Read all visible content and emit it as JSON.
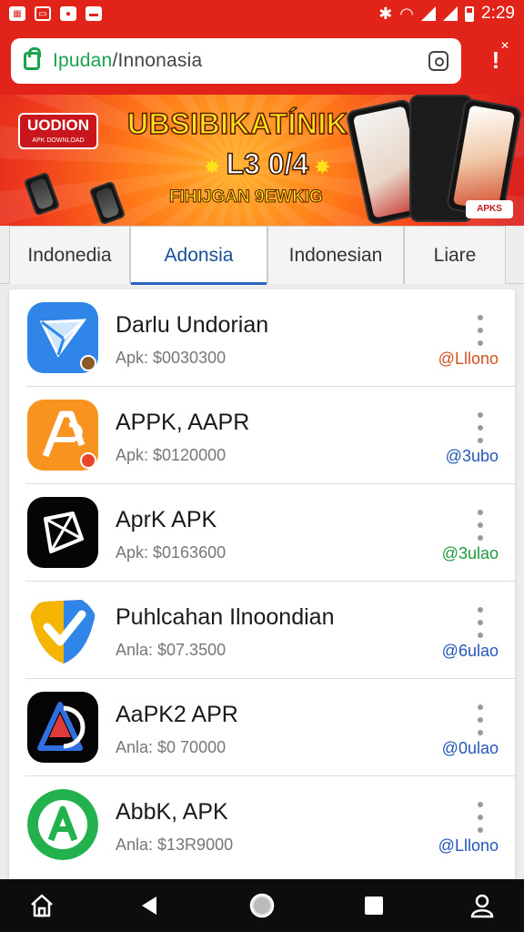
{
  "status_bar": {
    "left_icons": [
      "photo-notification-icon",
      "calendar-notification-icon",
      "chat-notification-icon",
      "video-notification-icon"
    ],
    "right_icons": [
      "bluetooth-icon",
      "wifi-icon",
      "signal-icon",
      "signal-icon",
      "battery-icon"
    ],
    "time": "2:29"
  },
  "browser": {
    "url_host": "Ipudan",
    "url_path": "/Innonasia"
  },
  "banner": {
    "logo_text": "UODION",
    "logo_subtext": "APK DOWNLOAD",
    "headline": "UBSIBIKATÍNIK!",
    "subheadline": "L3 0/4",
    "tagline": "FIHIJGAN 9EWKIG",
    "corner_badge": "APKS"
  },
  "tabs": [
    {
      "label": "Indonedia",
      "active": false
    },
    {
      "label": "Adonsia",
      "active": true
    },
    {
      "label": "Indonesian",
      "active": false
    },
    {
      "label": "Liare",
      "active": false
    }
  ],
  "apps": [
    {
      "name": "Darlu Undorian",
      "meta": "Apk: $0030300",
      "size": "@Lllono",
      "size_color": "#d1501e",
      "icon": "paper-plane-app-icon"
    },
    {
      "name": "APPK, AAPR",
      "meta": "Apk: $0120000",
      "size": "@3ubo",
      "size_color": "#2457b8",
      "icon": "letter-a-app-icon"
    },
    {
      "name": "AprK APK",
      "meta": "Apk: $0163600",
      "size": "@3ulao",
      "size_color": "#1f9a3c",
      "icon": "geometric-diamond-app-icon"
    },
    {
      "name": "Puhlcahan Ilnoondian",
      "meta": "Anla: $07.3500",
      "size": "@6ulao",
      "size_color": "#2457b8",
      "icon": "colorful-checkmark-app-icon"
    },
    {
      "name": "AaPK2 APR",
      "meta": "Anla: $0 70000",
      "size": "@0ulao",
      "size_color": "#2457b8",
      "icon": "triangle-a-app-icon"
    },
    {
      "name": "AbbK, APK",
      "meta": "Anla: $13R9000",
      "size": "@Lllono",
      "size_color": "#2457b8",
      "icon": "green-a-app-icon"
    }
  ],
  "nav_bar": [
    "home-icon",
    "back-icon",
    "recents-circle-icon",
    "square-icon",
    "profile-icon"
  ]
}
